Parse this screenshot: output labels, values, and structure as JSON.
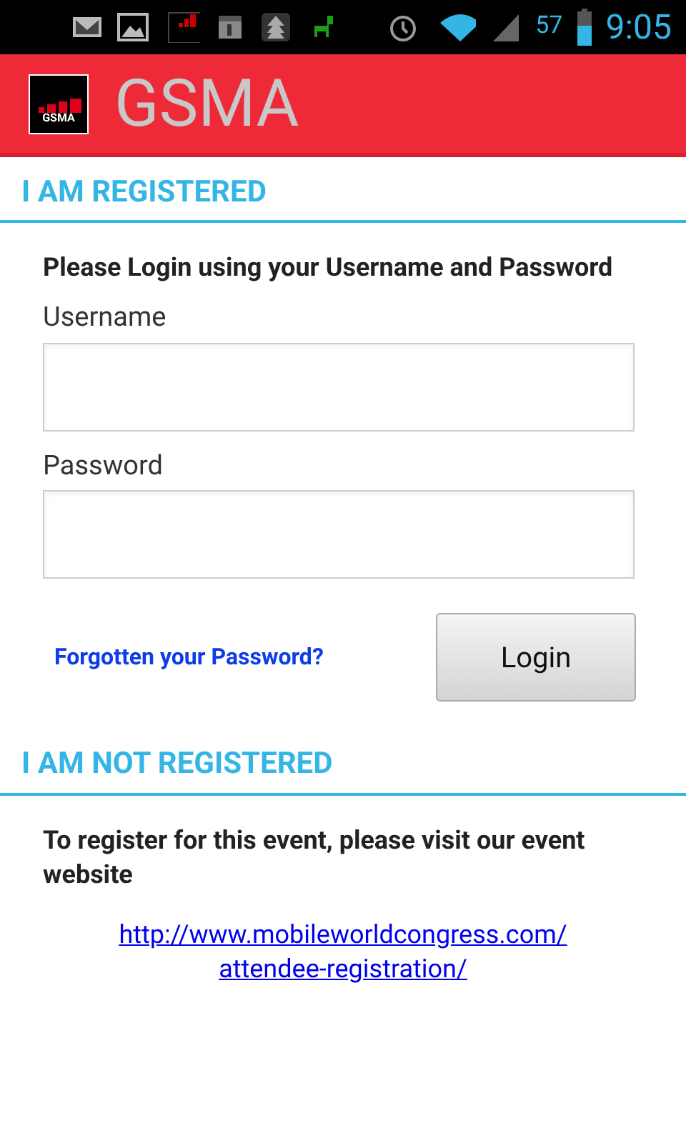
{
  "status_bar": {
    "battery": "57",
    "time": "9:05"
  },
  "app_bar": {
    "logo_text": "GSMA",
    "title": "GSMA"
  },
  "registered": {
    "heading": "I AM REGISTERED",
    "intro": "Please Login using your Username and Password",
    "username_label": "Username",
    "password_label": "Password",
    "forgot_link": "Forgotten your Password?",
    "login_button": "Login"
  },
  "not_registered": {
    "heading": "I AM NOT REGISTERED",
    "intro": "To register for this event, please visit our event website",
    "link_lines": [
      "http://www.mobileworldcongress.com/",
      "attendee-registration/"
    ]
  }
}
